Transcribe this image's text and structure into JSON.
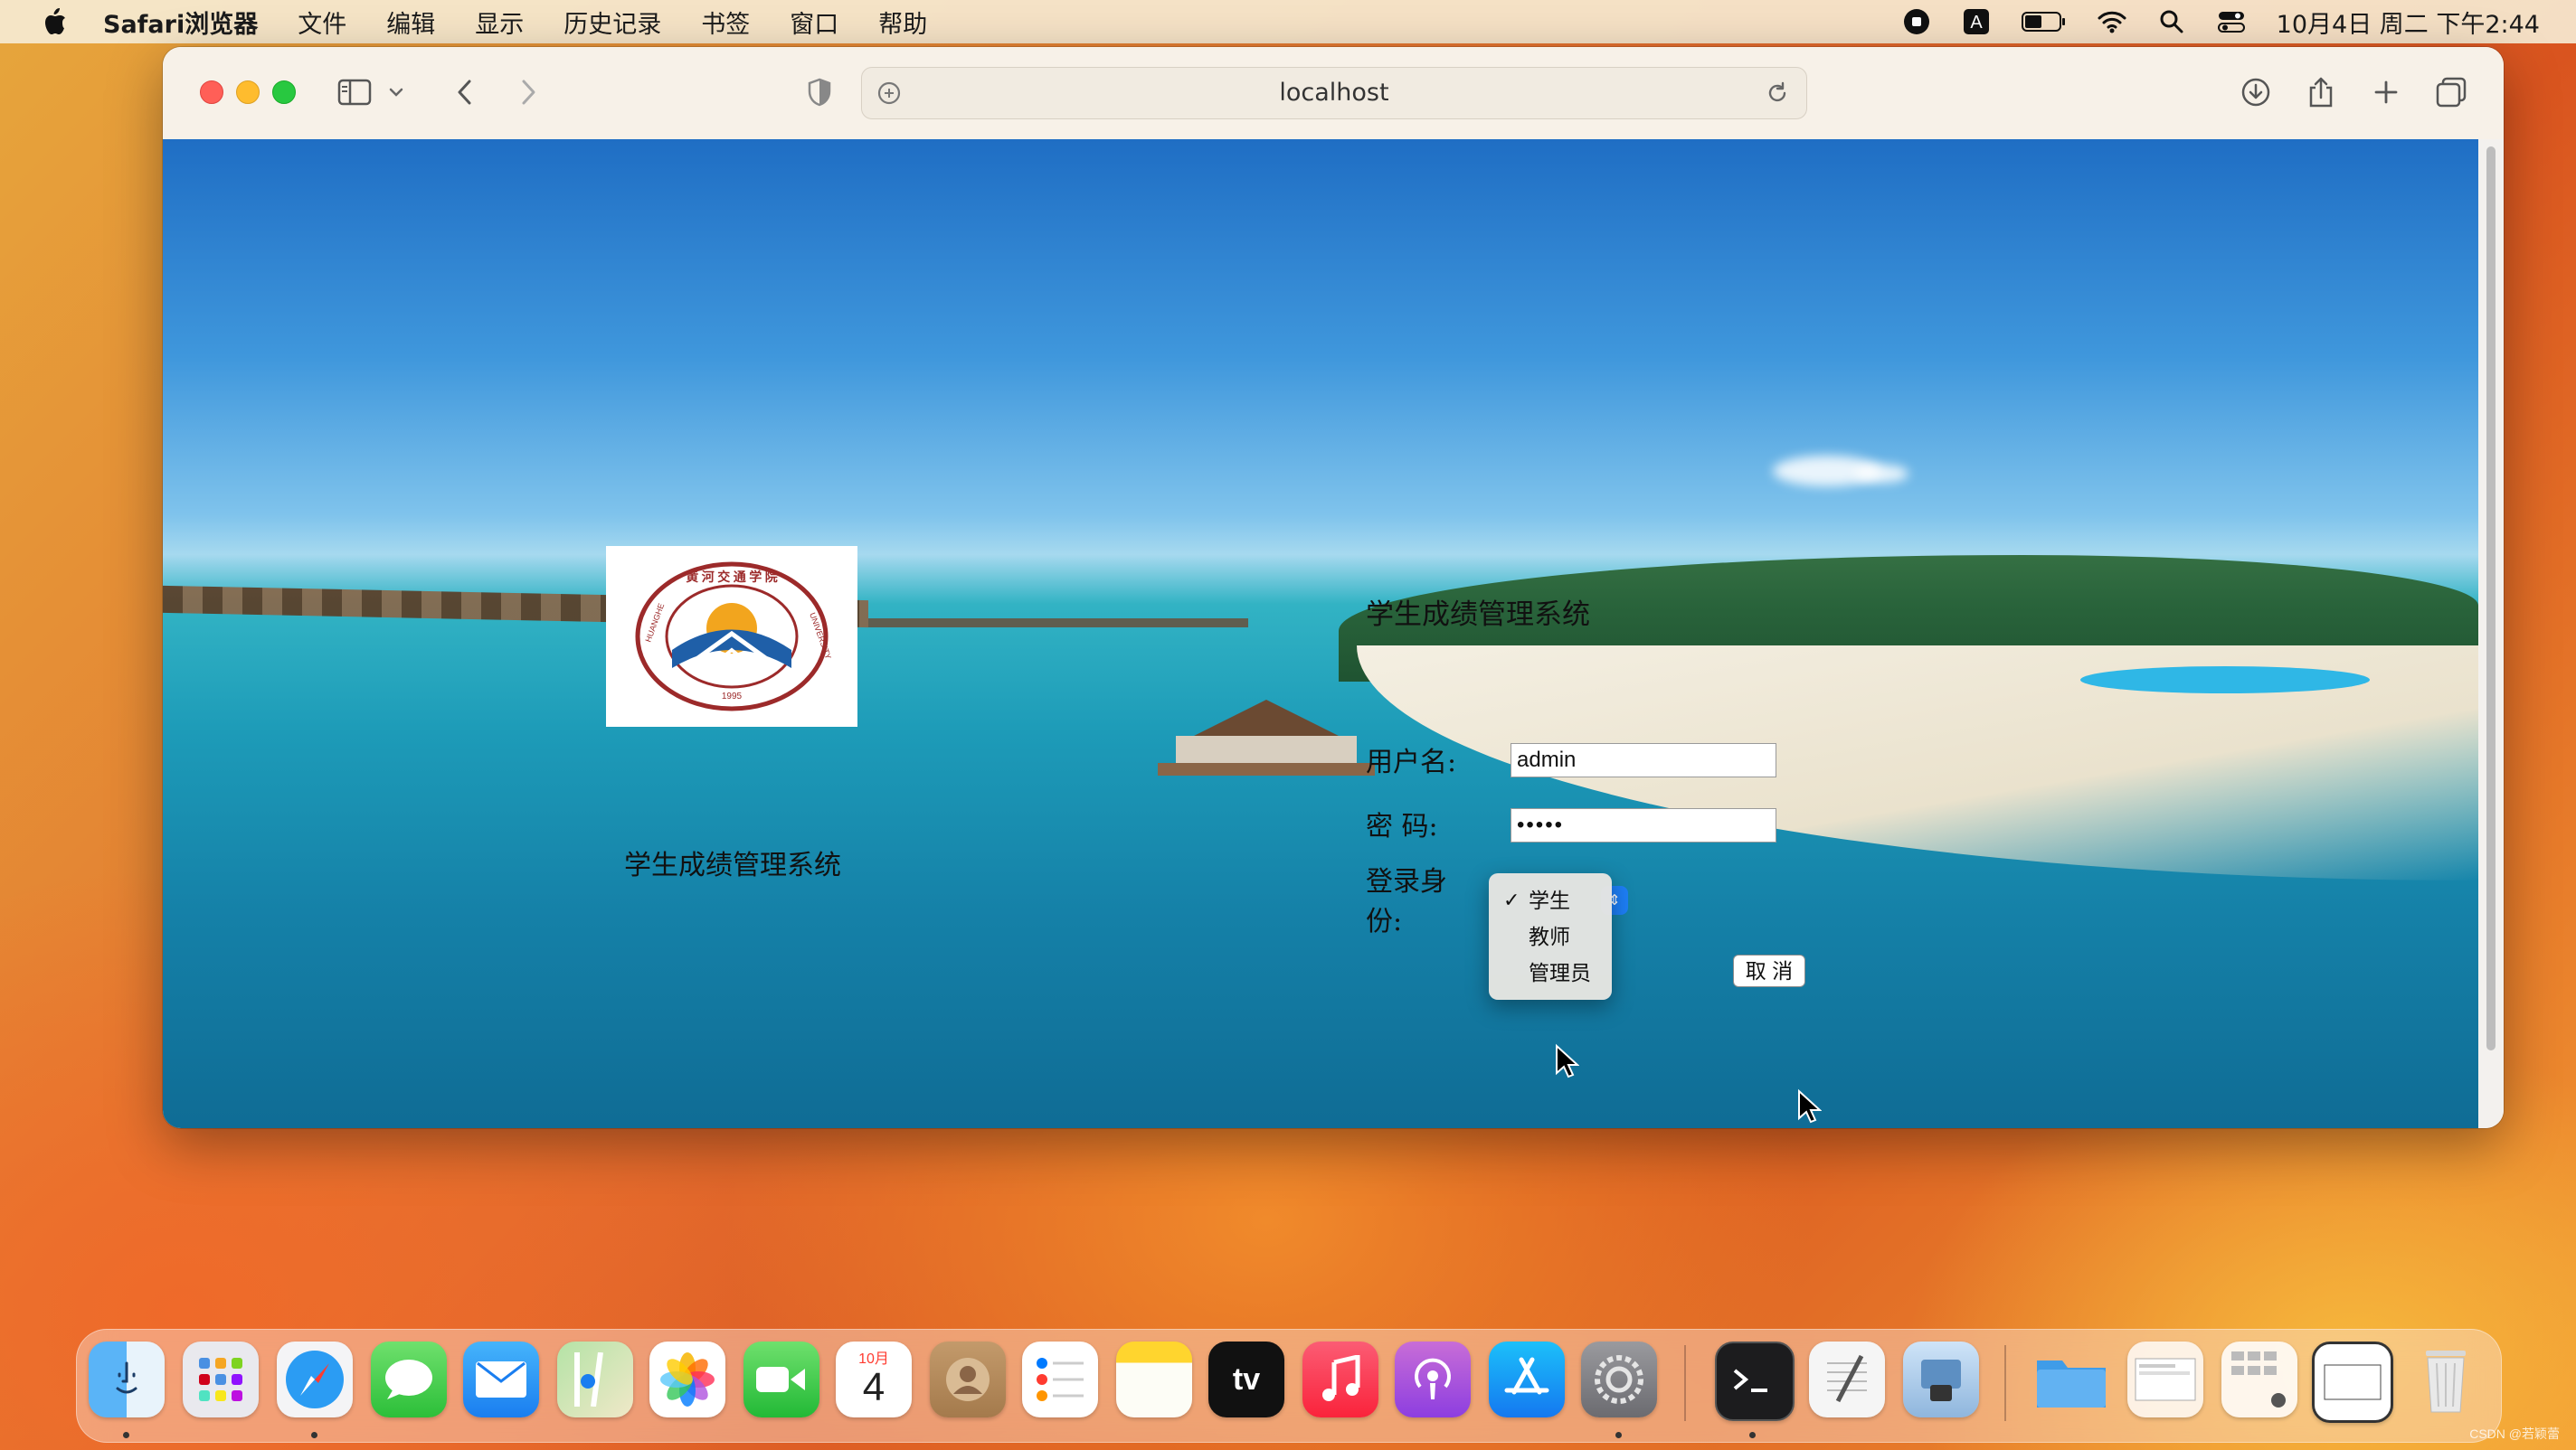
{
  "menubar": {
    "app_name": "Safari浏览器",
    "items": [
      "文件",
      "编辑",
      "显示",
      "历史记录",
      "书签",
      "窗口",
      "帮助"
    ],
    "clock": "10月4日 周二 下午2:44",
    "status_icons": [
      "screen-record-icon",
      "input-method-icon",
      "battery-icon",
      "wifi-icon",
      "spotlight-search-icon",
      "control-center-icon"
    ]
  },
  "browser": {
    "url": "localhost",
    "toolbar_icons": [
      "sidebar-icon",
      "chevron-down-icon",
      "back-icon",
      "forward-icon",
      "privacy-shield-icon",
      "download-icon",
      "share-icon",
      "new-tab-icon",
      "tab-overview-icon"
    ]
  },
  "page": {
    "logo_caption": "学生成绩管理系统",
    "form_title": "学生成绩管理系统",
    "username_label": "用户名:",
    "username_value": "admin",
    "password_label": "密 码:",
    "password_value": "•••••",
    "role_label": "登录身份:",
    "role_options": [
      {
        "label": "学生",
        "selected": true
      },
      {
        "label": "教师",
        "selected": false
      },
      {
        "label": "管理员",
        "selected": false
      }
    ],
    "cancel_label": "取 消",
    "logo_alt_text": "HUANGHE JIAOTONG UNIVERSITY 1995"
  },
  "dock": {
    "apps": [
      "Finder",
      "Launchpad",
      "Safari",
      "Messages",
      "Mail",
      "Maps",
      "Photos",
      "FaceTime",
      "Calendar",
      "Contacts",
      "Reminders",
      "Notes",
      "Apple TV",
      "Music",
      "Podcasts",
      "App Store",
      "System Settings",
      "Terminal",
      "TextEdit",
      "Preview",
      "Folder",
      "Window 1",
      "Window 2",
      "Window 3",
      "Trash"
    ],
    "calendar_month": "10月",
    "calendar_day": "4",
    "tv_label": "tv"
  },
  "watermark": "CSDN @若颖蕾"
}
